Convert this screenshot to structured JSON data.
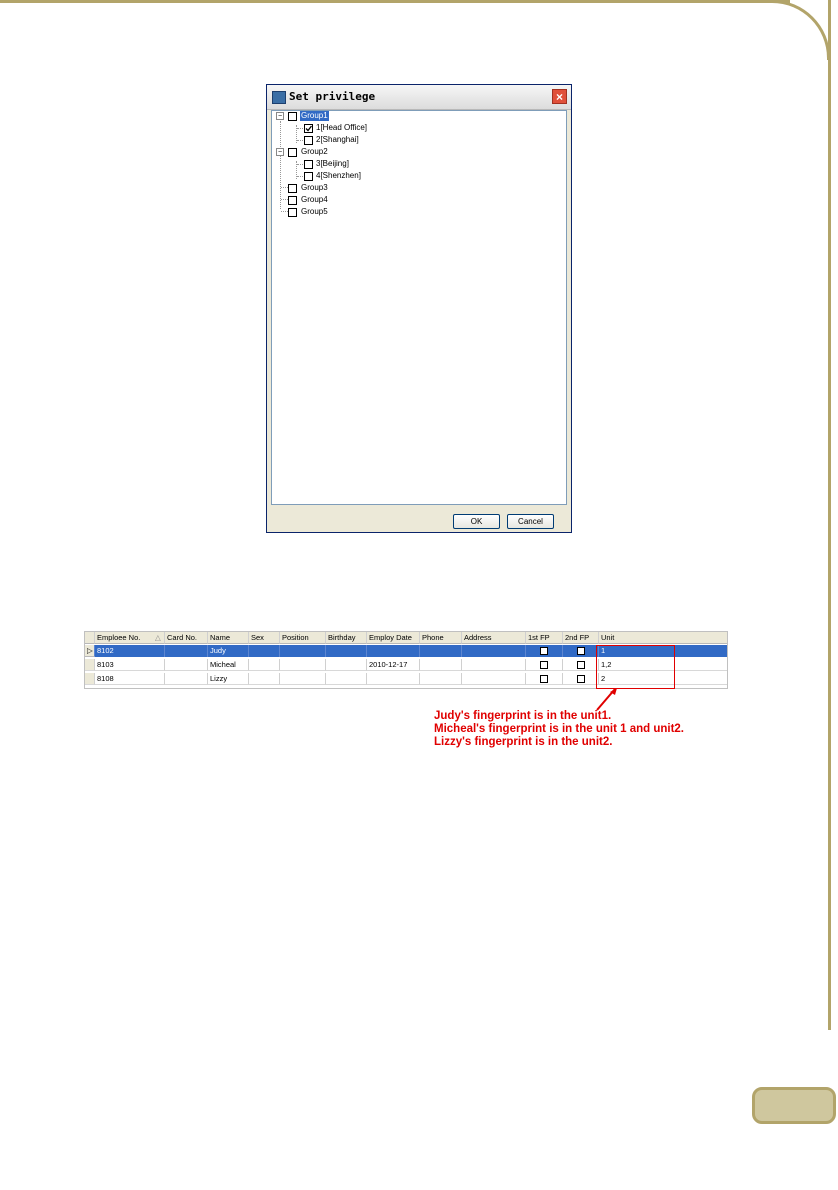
{
  "dialog": {
    "title": "Set privilege",
    "close_label": "×",
    "ok_label": "OK",
    "cancel_label": "Cancel",
    "tree": [
      {
        "label": "Group1",
        "checked": false,
        "selected": true,
        "expander": "−"
      },
      {
        "label": "1[Head Office]",
        "checked": true
      },
      {
        "label": "2[Shanghai]",
        "checked": false
      },
      {
        "label": "Group2",
        "checked": false,
        "expander": "−"
      },
      {
        "label": "3[Beijing]",
        "checked": false
      },
      {
        "label": "4[Shenzhen]",
        "checked": false
      },
      {
        "label": "Group3",
        "checked": false
      },
      {
        "label": "Group4",
        "checked": false
      },
      {
        "label": "Group5",
        "checked": false
      }
    ]
  },
  "grid": {
    "columns": [
      "Emploee No.",
      "Card No.",
      "Name",
      "Sex",
      "Position",
      "Birthday",
      "Employ Date",
      "Phone",
      "Address",
      "1st FP",
      "2nd FP",
      "Unit"
    ],
    "sort_indicator": "△",
    "row_indicator": "▷",
    "rows": [
      {
        "emp_no": "8102",
        "card": "",
        "name": "Judy",
        "sex": "",
        "position": "",
        "birthday": "",
        "employ_date": "",
        "phone": "",
        "address": "",
        "unit": "1"
      },
      {
        "emp_no": "8103",
        "card": "",
        "name": "Micheal",
        "sex": "",
        "position": "",
        "birthday": "",
        "employ_date": "2010-12-17",
        "phone": "",
        "address": "",
        "unit": "1,2"
      },
      {
        "emp_no": "8108",
        "card": "",
        "name": "Lizzy",
        "sex": "",
        "position": "",
        "birthday": "",
        "employ_date": "",
        "phone": "",
        "address": "",
        "unit": "2"
      }
    ]
  },
  "annotation": [
    "Judy's fingerprint is in the unit1.",
    "Micheal's fingerprint is in the unit 1 and unit2.",
    "Lizzy's fingerprint is in the unit2."
  ],
  "colors": {
    "accent": "#e00000",
    "selection": "#316ac5",
    "page_border": "#b2a46a"
  }
}
